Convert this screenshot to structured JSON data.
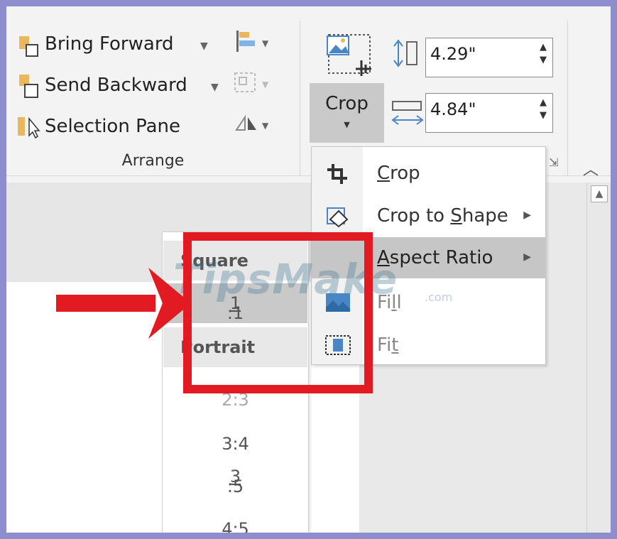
{
  "arrange": {
    "bring_forward": "Bring Forward",
    "send_backward": "Send Backward",
    "selection_pane": "Selection Pane",
    "group_label": "Arrange"
  },
  "size": {
    "height_value": "4.29\"",
    "width_value": "4.84\""
  },
  "crop_button": {
    "label": "Crop"
  },
  "crop_menu": {
    "items": [
      {
        "label": "Crop",
        "mnemonic": "C",
        "rest": "rop"
      },
      {
        "label": "Crop to Shape",
        "pre": "Crop to ",
        "mnemonic": "S",
        "rest": "hape"
      },
      {
        "label": "Aspect Ratio",
        "mnemonic": "A",
        "rest": "spect Ratio"
      },
      {
        "label": "Fill",
        "pre": "Fi",
        "mnemonic": "l",
        "rest": "l"
      },
      {
        "label": "Fit",
        "pre": "Fi",
        "mnemonic": "t",
        "rest": ""
      }
    ]
  },
  "aspect_submenu": {
    "square_header": "Square",
    "square_items": [
      {
        "label": "1:1",
        "mnemonic": "1",
        "rest": ":1"
      }
    ],
    "portrait_header": "Portrait",
    "portrait_items": [
      {
        "label": "2:3",
        "mnemonic": "",
        "rest": "2:3"
      },
      {
        "label": "3:4",
        "mnemonic": "",
        "rest": "3:4"
      },
      {
        "label": "3:5",
        "mnemonic": "3",
        "rest": ":5"
      },
      {
        "label": "4:5",
        "mnemonic": "",
        "rest": "4:5"
      }
    ]
  },
  "watermark": {
    "text": "TipsMake",
    "suffix": ".com"
  },
  "colors": {
    "frame": "#8e8ecf",
    "highlight_red": "#e21b22",
    "menu_highlight": "#c6c6c6"
  }
}
